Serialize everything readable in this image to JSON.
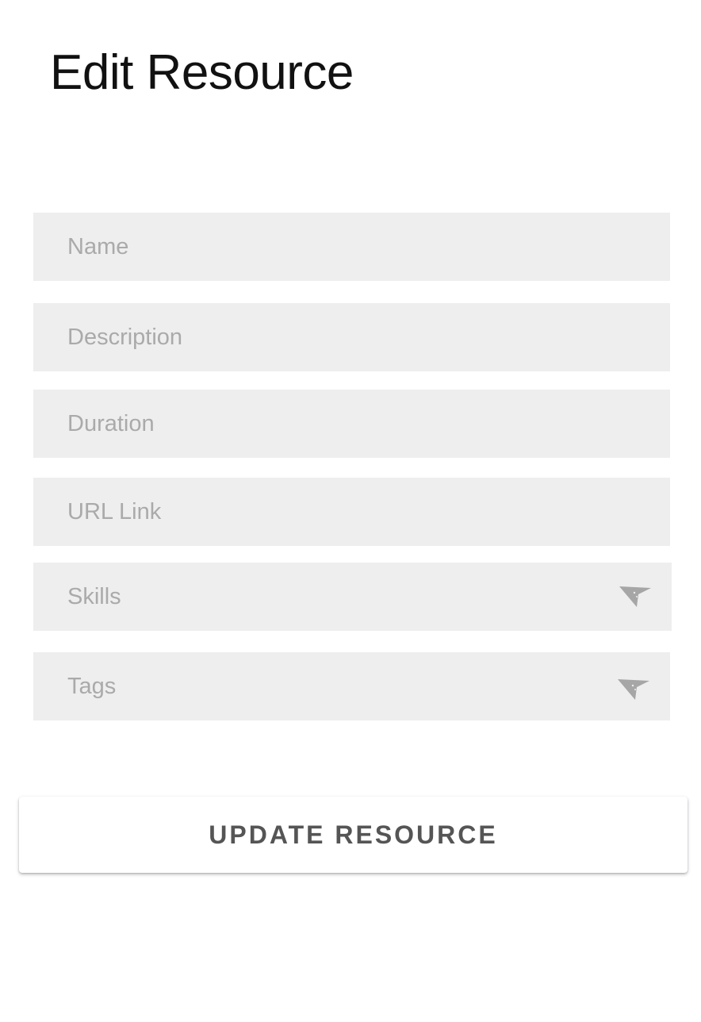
{
  "header": {
    "title": "Edit Resource"
  },
  "form": {
    "name": {
      "placeholder": "Name",
      "value": ""
    },
    "description": {
      "placeholder": "Description",
      "value": ""
    },
    "duration": {
      "placeholder": "Duration",
      "value": ""
    },
    "url_link": {
      "placeholder": "URL Link",
      "value": ""
    },
    "skills": {
      "label": "Skills",
      "icon": "chevron-down-icon"
    },
    "tags": {
      "label": "Tags",
      "icon": "chevron-down-icon"
    },
    "submit_label": "UPDATE RESOURCE"
  },
  "colors": {
    "field_background": "#eeeeee",
    "placeholder_text": "#aaaaaa",
    "button_text": "#555555",
    "title_text": "#111111"
  }
}
